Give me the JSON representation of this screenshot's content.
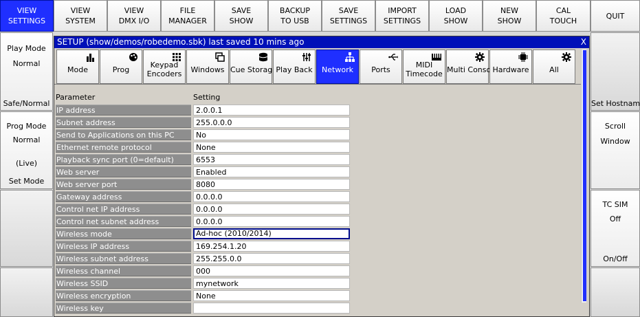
{
  "toolbar": [
    {
      "l1": "VIEW",
      "l2": "SETTINGS",
      "active": true
    },
    {
      "l1": "VIEW",
      "l2": "SYSTEM"
    },
    {
      "l1": "VIEW",
      "l2": "DMX I/O"
    },
    {
      "l1": "FILE",
      "l2": "MANAGER"
    },
    {
      "l1": "SAVE",
      "l2": "SHOW"
    },
    {
      "l1": "BACKUP",
      "l2": "TO USB"
    },
    {
      "l1": "SAVE",
      "l2": "SETTINGS"
    },
    {
      "l1": "IMPORT",
      "l2": "SETTINGS"
    },
    {
      "l1": "LOAD",
      "l2": "SHOW"
    },
    {
      "l1": "NEW",
      "l2": "SHOW"
    },
    {
      "l1": "CAL",
      "l2": "TOUCH"
    },
    {
      "l1": "QUIT",
      "l2": ""
    }
  ],
  "left_panel": {
    "play_mode": {
      "title": "Play Mode",
      "value": "Normal",
      "action": "Safe/Normal"
    },
    "prog_mode": {
      "title": "Prog Mode",
      "value": "Normal",
      "extra": "(Live)",
      "action": "Set Mode"
    }
  },
  "right_panel": {
    "hostname": {
      "action": "Set Hostname"
    },
    "scroll": {
      "title": "Scroll",
      "value": "Window"
    },
    "tc_sim": {
      "title": "TC SIM",
      "value": "Off",
      "action": "On/Off"
    }
  },
  "setup": {
    "title": "SETUP (show/demos/robedemo.sbk) last saved 10 mins ago",
    "close": "X",
    "tabs": [
      {
        "label": "Mode",
        "icon": "fader-icon"
      },
      {
        "label": "Prog",
        "icon": "palette-icon"
      },
      {
        "label": "Keypad\nEncoders",
        "icon": "keypad-icon"
      },
      {
        "label": "Windows",
        "icon": "windows-icon"
      },
      {
        "label": "Cue Storage",
        "icon": "database-icon"
      },
      {
        "label": "Play Back",
        "icon": "sliders-icon"
      },
      {
        "label": "Network",
        "icon": "network-icon",
        "active": true
      },
      {
        "label": "Ports",
        "icon": "usb-icon"
      },
      {
        "label": "MIDI\nTimecode",
        "icon": "midi-icon"
      },
      {
        "label": "Multi Console",
        "icon": "gear-icon"
      },
      {
        "label": "Hardware",
        "icon": "chip-icon"
      },
      {
        "label": "All",
        "icon": "gear-icon"
      }
    ],
    "table": {
      "headers": {
        "param": "Parameter",
        "setting": "Setting"
      },
      "rows": [
        {
          "param": "IP address",
          "setting": "2.0.0.1"
        },
        {
          "param": "Subnet address",
          "setting": "255.0.0.0"
        },
        {
          "param": "Send to Applications on this PC",
          "setting": "No"
        },
        {
          "param": "Ethernet remote protocol",
          "setting": "None"
        },
        {
          "param": "Playback sync port (0=default)",
          "setting": "6553"
        },
        {
          "param": "Web server",
          "setting": "Enabled"
        },
        {
          "param": "Web server port",
          "setting": "8080"
        },
        {
          "param": "Gateway address",
          "setting": "0.0.0.0"
        },
        {
          "param": "Control net IP address",
          "setting": "0.0.0.0"
        },
        {
          "param": "Control net subnet address",
          "setting": "0.0.0.0"
        },
        {
          "param": "Wireless mode",
          "setting": "Ad-hoc (2010/2014)",
          "focused": true
        },
        {
          "param": "Wireless IP address",
          "setting": "169.254.1.20"
        },
        {
          "param": "Wireless subnet address",
          "setting": "255.255.0.0"
        },
        {
          "param": "Wireless channel",
          "setting": "000"
        },
        {
          "param": "Wireless SSID",
          "setting": "mynetwork"
        },
        {
          "param": "Wireless encryption",
          "setting": "None"
        },
        {
          "param": "Wireless key",
          "setting": ""
        }
      ]
    }
  },
  "colors": {
    "accent": "#1f2fff",
    "titlebar": "#0010b8",
    "param_bg": "#8e8e8e"
  }
}
